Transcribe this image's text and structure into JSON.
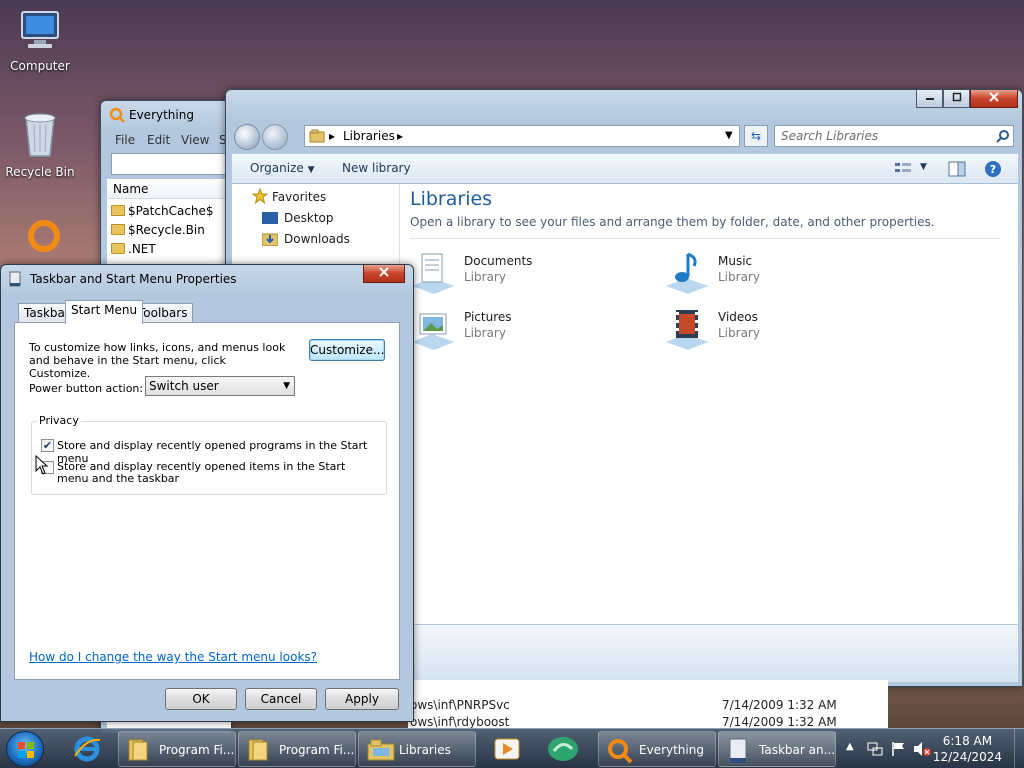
{
  "desktop": {
    "icons": [
      {
        "label": "Computer"
      },
      {
        "label": "Recycle Bin"
      }
    ]
  },
  "everything": {
    "title": "Everything",
    "menu": [
      "File",
      "Edit",
      "View",
      "S"
    ],
    "column": "Name",
    "rows": [
      "$PatchCache$",
      "$Recycle.Bin",
      ".NET"
    ]
  },
  "explorer": {
    "address_crumb": "Libraries",
    "search_placeholder": "Search Libraries",
    "toolbar": {
      "organize": "Organize",
      "new_library": "New library"
    },
    "nav": {
      "favorites": "Favorites",
      "desktop": "Desktop",
      "downloads": "Downloads"
    },
    "heading": "Libraries",
    "subheading": "Open a library to see your files and arrange them by folder, date, and other properties.",
    "libraries": [
      {
        "name": "Documents",
        "kind": "Library"
      },
      {
        "name": "Music",
        "kind": "Library"
      },
      {
        "name": "Pictures",
        "kind": "Library"
      },
      {
        "name": "Videos",
        "kind": "Library"
      }
    ]
  },
  "bg_list": {
    "rows": [
      {
        "path": "ows\\inf\\PNRPSvc",
        "date": "7/14/2009 1:32 AM"
      },
      {
        "path": "ows\\inf\\rdyboost",
        "date": "7/14/2009 1:32 AM"
      }
    ]
  },
  "dialog": {
    "title": "Taskbar and Start Menu Properties",
    "close": "x",
    "tabs": [
      "Taskbar",
      "Start Menu",
      "Toolbars"
    ],
    "intro": "To customize how links, icons, and menus look and behave in the Start menu, click Customize.",
    "customize_button": "Customize...",
    "power_label": "Power button action:",
    "power_value": "Switch user",
    "privacy_group": "Privacy",
    "check1": {
      "label": "Store and display recently opened programs in the Start menu",
      "checked": true
    },
    "check2": {
      "label": "Store and display recently opened items in the Start menu and the taskbar",
      "checked": false
    },
    "help_link": "How do I change the way the Start menu looks?",
    "buttons": {
      "ok": "OK",
      "cancel": "Cancel",
      "apply": "Apply"
    }
  },
  "taskbar": {
    "buttons": [
      {
        "label": "Program Fi..."
      },
      {
        "label": "Program Fi..."
      },
      {
        "label": "Libraries"
      },
      {
        "label": "Everything"
      },
      {
        "label": "Taskbar an..."
      }
    ],
    "time": "6:18 AM",
    "date": "12/24/2024"
  }
}
